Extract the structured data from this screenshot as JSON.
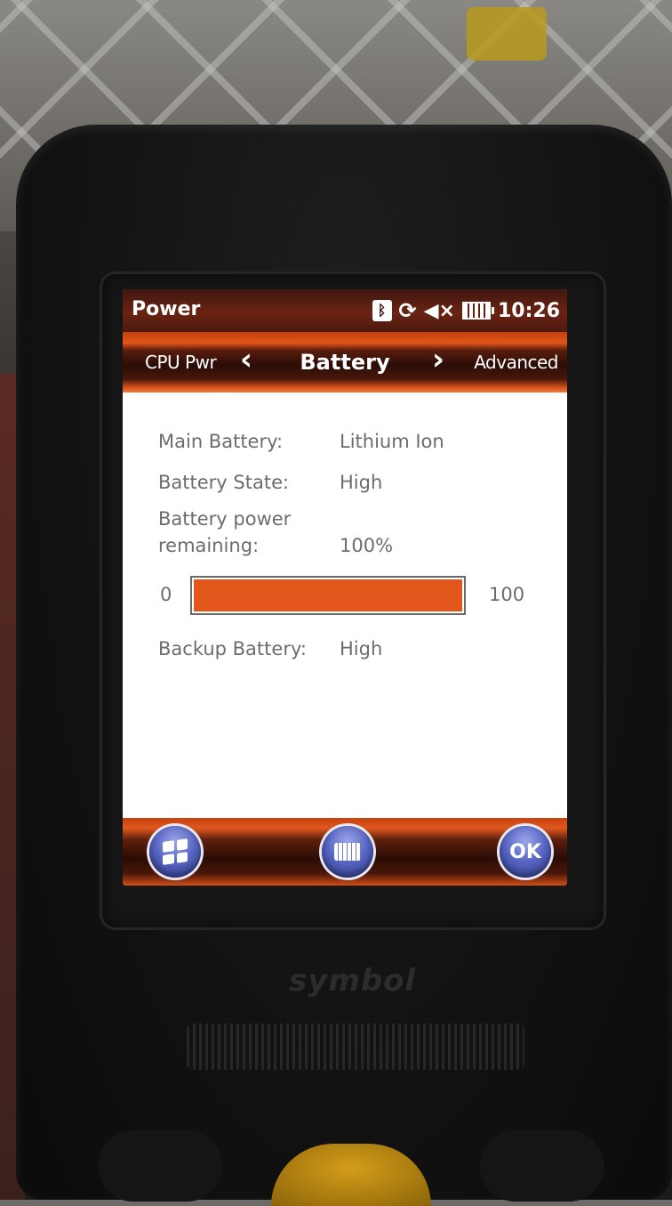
{
  "status_bar": {
    "title": "Power",
    "clock": "10:26",
    "icons": [
      "bluetooth-icon",
      "sync-icon",
      "speaker-muted-icon",
      "battery-icon"
    ]
  },
  "tabs": {
    "previous": "CPU Pwr",
    "current": "Battery",
    "next": "Advanced"
  },
  "battery_info": {
    "main_battery_label": "Main Battery:",
    "main_battery_value": "Lithium Ion",
    "battery_state_label": "Battery State:",
    "battery_state_value": "High",
    "power_remaining_label_line1": "Battery power",
    "power_remaining_label_line2": "remaining:",
    "power_remaining_value": "100%",
    "progress_min": "0",
    "progress_max": "100",
    "progress_fraction": 1.0,
    "backup_battery_label": "Backup Battery:",
    "backup_battery_value": "High"
  },
  "softkeys": {
    "ok_label": "OK"
  },
  "device": {
    "brand": "symbol"
  },
  "colors": {
    "accent_orange": "#e3561b",
    "titlebar_dark": "#3f1710",
    "softkey_blue": "#5867c4"
  }
}
